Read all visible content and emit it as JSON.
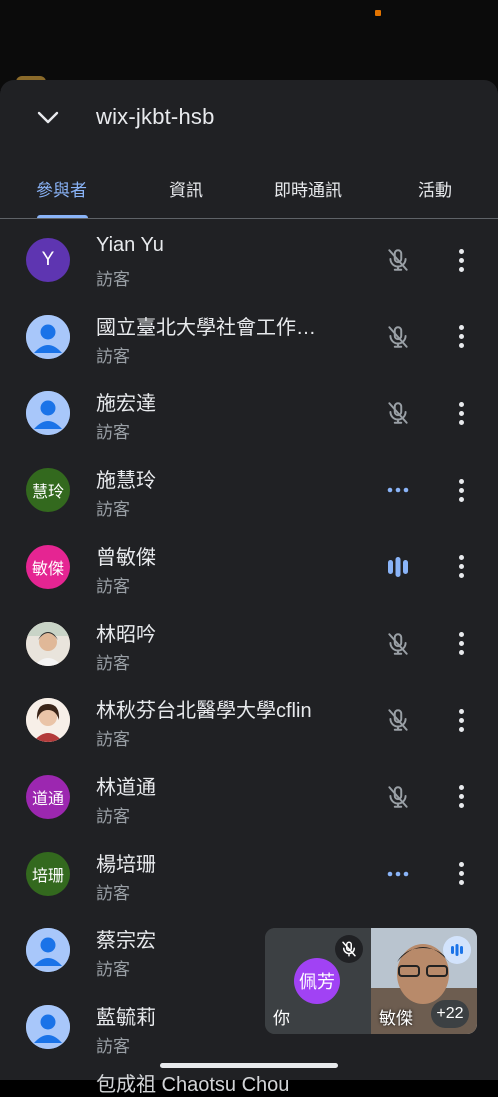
{
  "meeting": {
    "code": "wix-jkbt-hsb"
  },
  "tabs": [
    {
      "label": "參與者",
      "active": true
    },
    {
      "label": "資訊",
      "active": false
    },
    {
      "label": "即時通訊",
      "active": false
    },
    {
      "label": "活動",
      "active": false
    }
  ],
  "colors": {
    "accent": "#8ab4f8",
    "sheet_bg": "#202124",
    "secondary_text": "#9aa0a6"
  },
  "participants": [
    {
      "name": "Yian Yu",
      "role": "訪客",
      "avatar_text": "Y",
      "avatar_color": "#5e35b1",
      "avatar_type": "initial",
      "status": "muted"
    },
    {
      "name": "國立臺北大學社會工作…",
      "role": "訪客",
      "avatar_text": "",
      "avatar_color": "#a8c7fa",
      "avatar_type": "generic",
      "status": "muted"
    },
    {
      "name": "施宏達",
      "role": "訪客",
      "avatar_text": "",
      "avatar_color": "#a8c7fa",
      "avatar_type": "generic",
      "status": "muted"
    },
    {
      "name": "施慧玲",
      "role": "訪客",
      "avatar_text": "慧玲",
      "avatar_color": "#33691e",
      "avatar_type": "initial",
      "status": "idle"
    },
    {
      "name": "曾敏傑",
      "role": "訪客",
      "avatar_text": "敏傑",
      "avatar_color": "#e52592",
      "avatar_type": "initial",
      "status": "speaking"
    },
    {
      "name": "林昭吟",
      "role": "訪客",
      "avatar_text": "",
      "avatar_color": "#d9c6b4",
      "avatar_type": "photo",
      "status": "muted"
    },
    {
      "name": "林秋芬台北醫學大學cflin",
      "role": "訪客",
      "avatar_text": "",
      "avatar_color": "#f1e4da",
      "avatar_type": "photo",
      "status": "muted"
    },
    {
      "name": "林道通",
      "role": "訪客",
      "avatar_text": "道通",
      "avatar_color": "#9c27b0",
      "avatar_type": "initial",
      "status": "muted"
    },
    {
      "name": "楊培珊",
      "role": "訪客",
      "avatar_text": "培珊",
      "avatar_color": "#33691e",
      "avatar_type": "initial",
      "status": "idle"
    },
    {
      "name": "蔡宗宏",
      "role": "訪客",
      "avatar_text": "",
      "avatar_color": "#a8c7fa",
      "avatar_type": "generic",
      "status": "hidden"
    },
    {
      "name": "藍毓莉",
      "role": "訪客",
      "avatar_text": "",
      "avatar_color": "#a8c7fa",
      "avatar_type": "generic",
      "status": "hidden"
    }
  ],
  "cut_off_row_text": "包成祖 Chaotsu Chou",
  "pip": {
    "self_avatar_text": "佩芳",
    "self_label": "你",
    "other_label": "敏傑",
    "more_count": "+22"
  }
}
